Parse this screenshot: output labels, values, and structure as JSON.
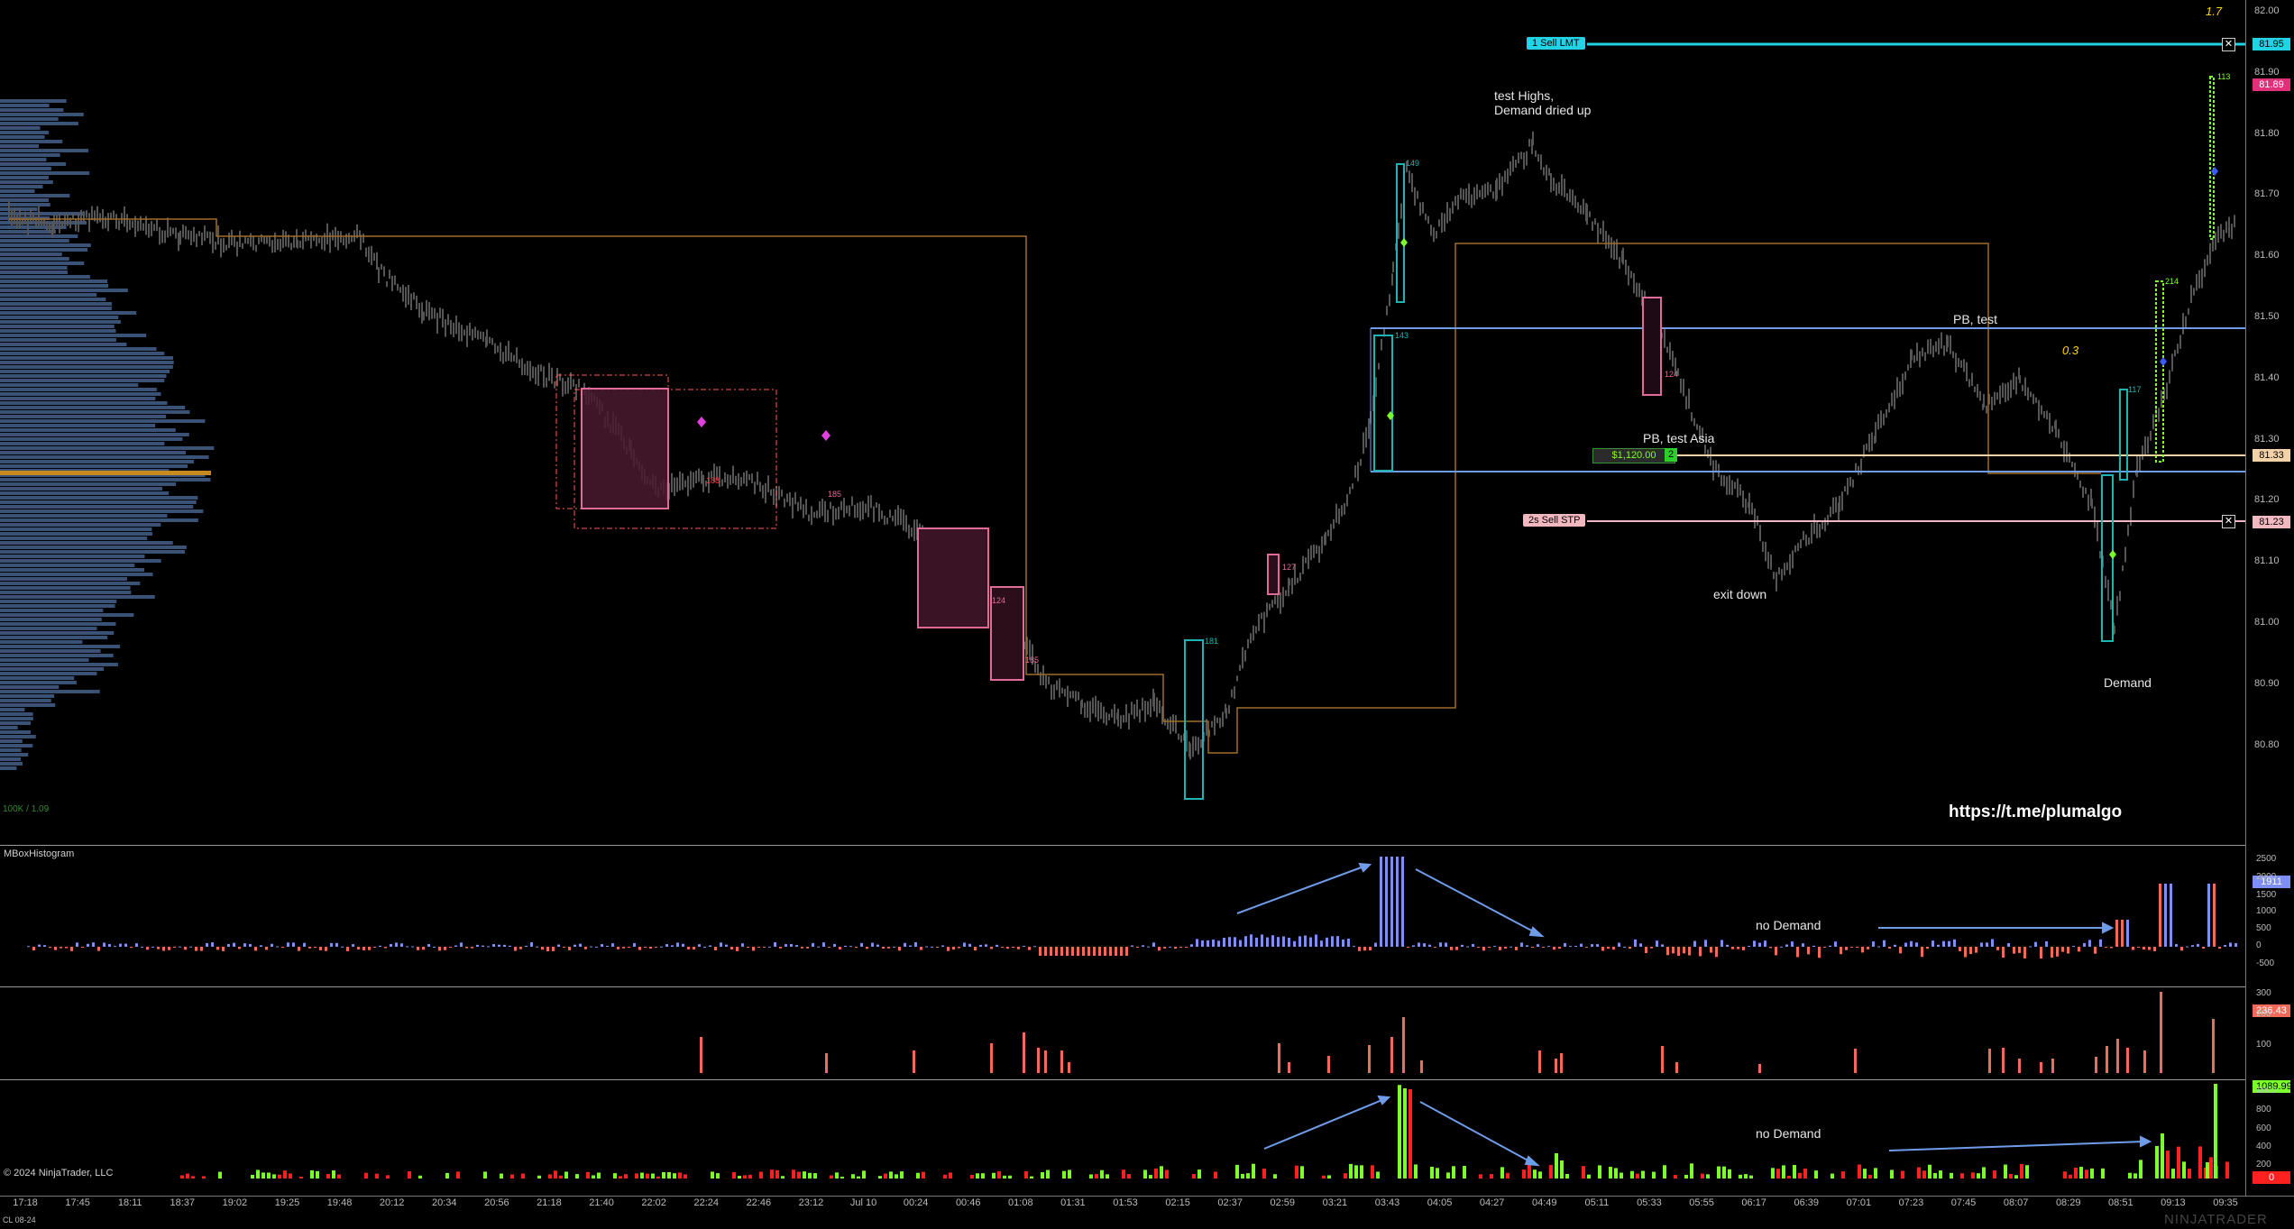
{
  "annotations": {
    "test_highs_line1": "test Highs,",
    "test_highs_line2": "Demand dried up",
    "pb_test": "PB,  test",
    "pb_test_asia": "PB,  test Asia",
    "exit_down": "exit down",
    "demand": "Demand",
    "val_1_7": "1.7",
    "val_0_3": "0.3",
    "url": "https://t.me/plumalgo",
    "no_demand_1": "no Demand",
    "no_demand_2": "no Demand",
    "range_info": "100K / 1.09"
  },
  "orders": {
    "sell_lmt": {
      "label": "1  Sell LMT",
      "price": "81.95"
    },
    "sell_stp": {
      "label": "2s  Sell STP",
      "price": "81.23"
    },
    "position": {
      "pnl": "$1,120.00",
      "qty": "2",
      "price": "81.33"
    }
  },
  "price_tags": {
    "last": "81.89",
    "hist": "1911",
    "mid_panel": "236.43",
    "bottom_panel_top": "1089.99",
    "bottom_panel_zero": "0"
  },
  "box_labels": {
    "b149": "149",
    "b143": "143",
    "b124a": "124",
    "b124b": "124",
    "b185a": "185",
    "b185b": "185",
    "b127": "127",
    "b181": "181",
    "b188": "188",
    "b214": "214",
    "b117": "117",
    "b113": "113"
  },
  "price_axis": [
    "82.00",
    "81.90",
    "81.80",
    "81.70",
    "81.60",
    "81.50",
    "81.40",
    "81.30",
    "81.20",
    "81.10",
    "81.00",
    "80.90",
    "80.80"
  ],
  "hist_axis": [
    "2500",
    "2000",
    "1500",
    "1000",
    "500",
    "0",
    "-500"
  ],
  "mid_axis": [
    "300",
    "200",
    "100"
  ],
  "bottom_axis": [
    "1000",
    "800",
    "600",
    "400",
    "200"
  ],
  "time_axis": [
    "17:18",
    "17:45",
    "18:11",
    "18:37",
    "19:02",
    "19:25",
    "19:48",
    "20:12",
    "20:34",
    "20:56",
    "21:18",
    "21:40",
    "22:02",
    "22:24",
    "22:46",
    "23:12",
    "Jul 10",
    "00:24",
    "00:46",
    "01:08",
    "01:31",
    "01:53",
    "02:15",
    "02:37",
    "02:59",
    "03:21",
    "03:43",
    "04:05",
    "04:27",
    "04:49",
    "05:11",
    "05:33",
    "05:55",
    "06:17",
    "06:39",
    "07:01",
    "07:23",
    "07:45",
    "08:07",
    "08:29",
    "08:51",
    "09:13",
    "09:35"
  ],
  "panels": {
    "hist_title": "MBoxHistogram",
    "copyright": "© 2024 NinjaTrader, LLC",
    "instrument": "CL 08-24",
    "brand": "NINJATRADER"
  },
  "colors": {
    "background": "#000000",
    "candle": "#555555",
    "volume_profile": "#3a5276",
    "poc": "#c68a1e",
    "sell_lmt": "#22d3e6",
    "sell_stp": "#f2b8c0",
    "position": "#f4d2a8",
    "last_price": "#e0307a",
    "supply_box": "#e06a98",
    "demand_box": "#1fb3b3",
    "level_line": "#6f9ce8",
    "va_line": "#a06d28",
    "green_bar": "#7cff2a",
    "red_bar": "#ff2020",
    "salmon_bar": "#f26b5a"
  }
}
